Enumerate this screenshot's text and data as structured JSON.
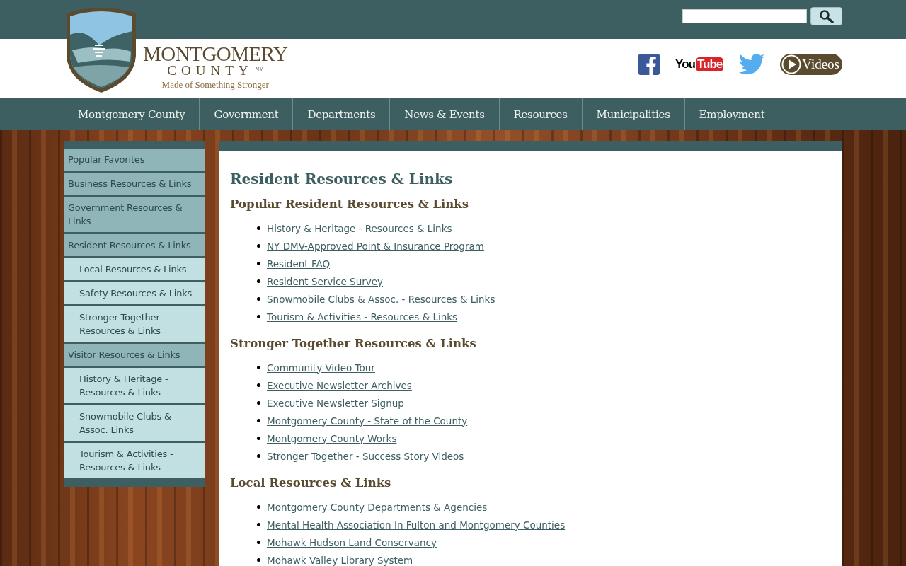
{
  "header": {
    "logo": {
      "name": "MONTGOMERY",
      "county": "COUNTY",
      "state": "NY",
      "tagline": "Made of Something Stronger"
    },
    "social": [
      {
        "kind": "facebook"
      },
      {
        "kind": "youtube",
        "label_a": "You",
        "label_b": "Tube"
      },
      {
        "kind": "twitter"
      },
      {
        "kind": "videos",
        "label": "Videos"
      }
    ]
  },
  "nav": [
    "Montgomery County",
    "Government",
    "Departments",
    "News & Events",
    "Resources",
    "Municipalities",
    "Employment"
  ],
  "sidebar": [
    {
      "label": "Popular Favorites"
    },
    {
      "label": "Business Resources & Links"
    },
    {
      "label": "Government Resources & Links"
    },
    {
      "label": "Resident Resources & Links",
      "children": [
        {
          "label": "Local Resources & Links"
        },
        {
          "label": "Safety Resources & Links"
        },
        {
          "label": "Stronger Together - Resources & Links"
        }
      ]
    },
    {
      "label": "Visitor Resources & Links",
      "children": [
        {
          "label": "History & Heritage - Resources & Links"
        },
        {
          "label": "Snowmobile Clubs & Assoc. Links"
        },
        {
          "label": "Tourism & Activities - Resources & Links"
        }
      ]
    }
  ],
  "content": {
    "title": "Resident Resources & Links",
    "sections": [
      {
        "heading": "Popular Resident Resources & Links",
        "links": [
          "History & Heritage - Resources & Links",
          "NY DMV-Approved Point & Insurance Program",
          "Resident FAQ",
          "Resident Service Survey",
          "Snowmobile Clubs & Assoc. - Resources & Links",
          "Tourism & Activities - Resources & Links"
        ]
      },
      {
        "heading": "Stronger Together Resources & Links",
        "links": [
          "Community Video Tour",
          "Executive Newsletter Archives",
          "Executive Newsletter Signup",
          "Montgomery County - State of the County",
          "Montgomery County Works",
          "Stronger Together - Success Story Videos"
        ]
      },
      {
        "heading": "Local Resources & Links",
        "links": [
          "Montgomery County Departments & Agencies",
          "Mental Health Association In Fulton and Montgomery Counties",
          "Mohawk Hudson Land Conservancy",
          "Mohawk Valley Library System"
        ]
      }
    ]
  }
}
